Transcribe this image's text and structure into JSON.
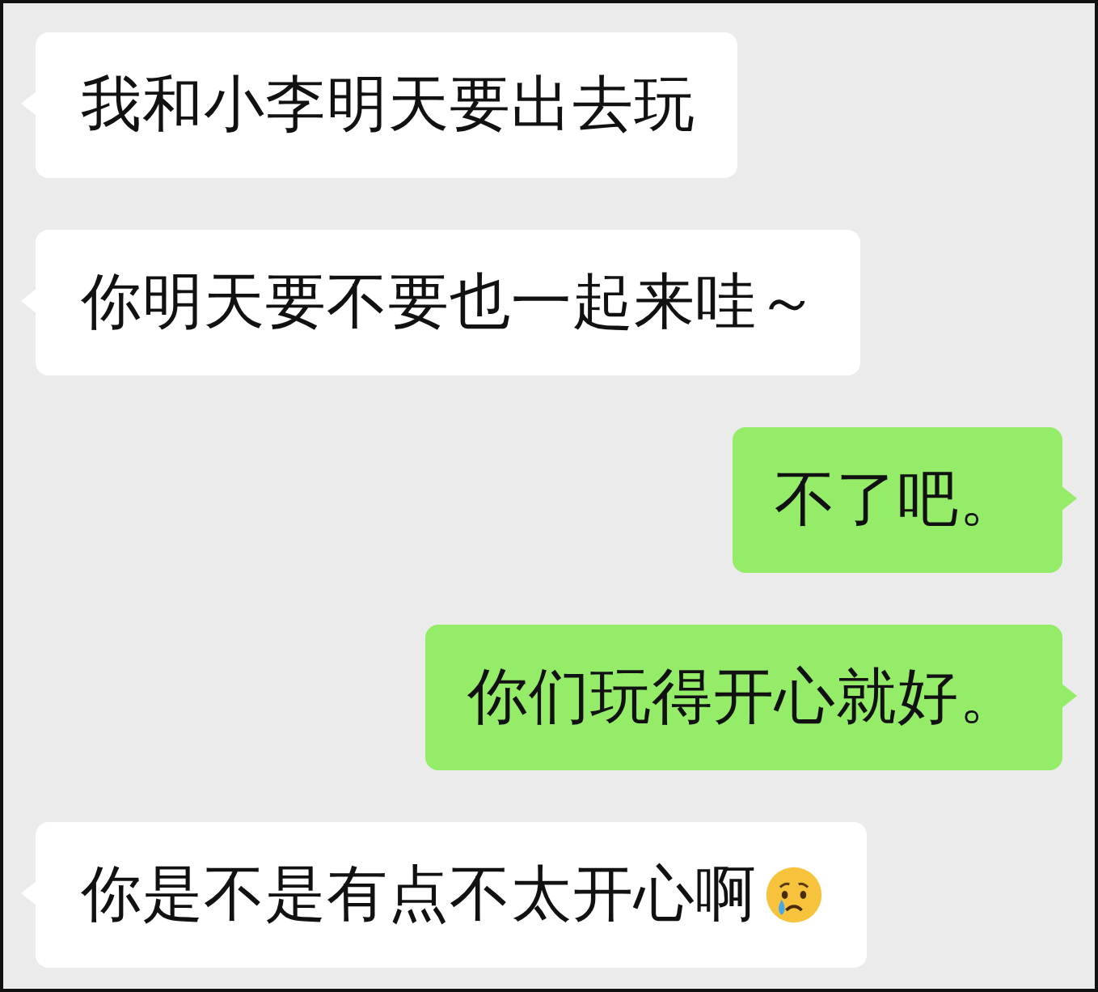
{
  "messages": [
    {
      "kind": "received",
      "text": "我和小李明天要出去玩"
    },
    {
      "kind": "received",
      "text": "你明天要不要也一起来哇～"
    },
    {
      "kind": "sent",
      "text": "不了吧。"
    },
    {
      "kind": "sent",
      "text": "你们玩得开心就好。"
    },
    {
      "kind": "received",
      "text": "你是不是有点不太开心啊",
      "emoji": true
    }
  ]
}
